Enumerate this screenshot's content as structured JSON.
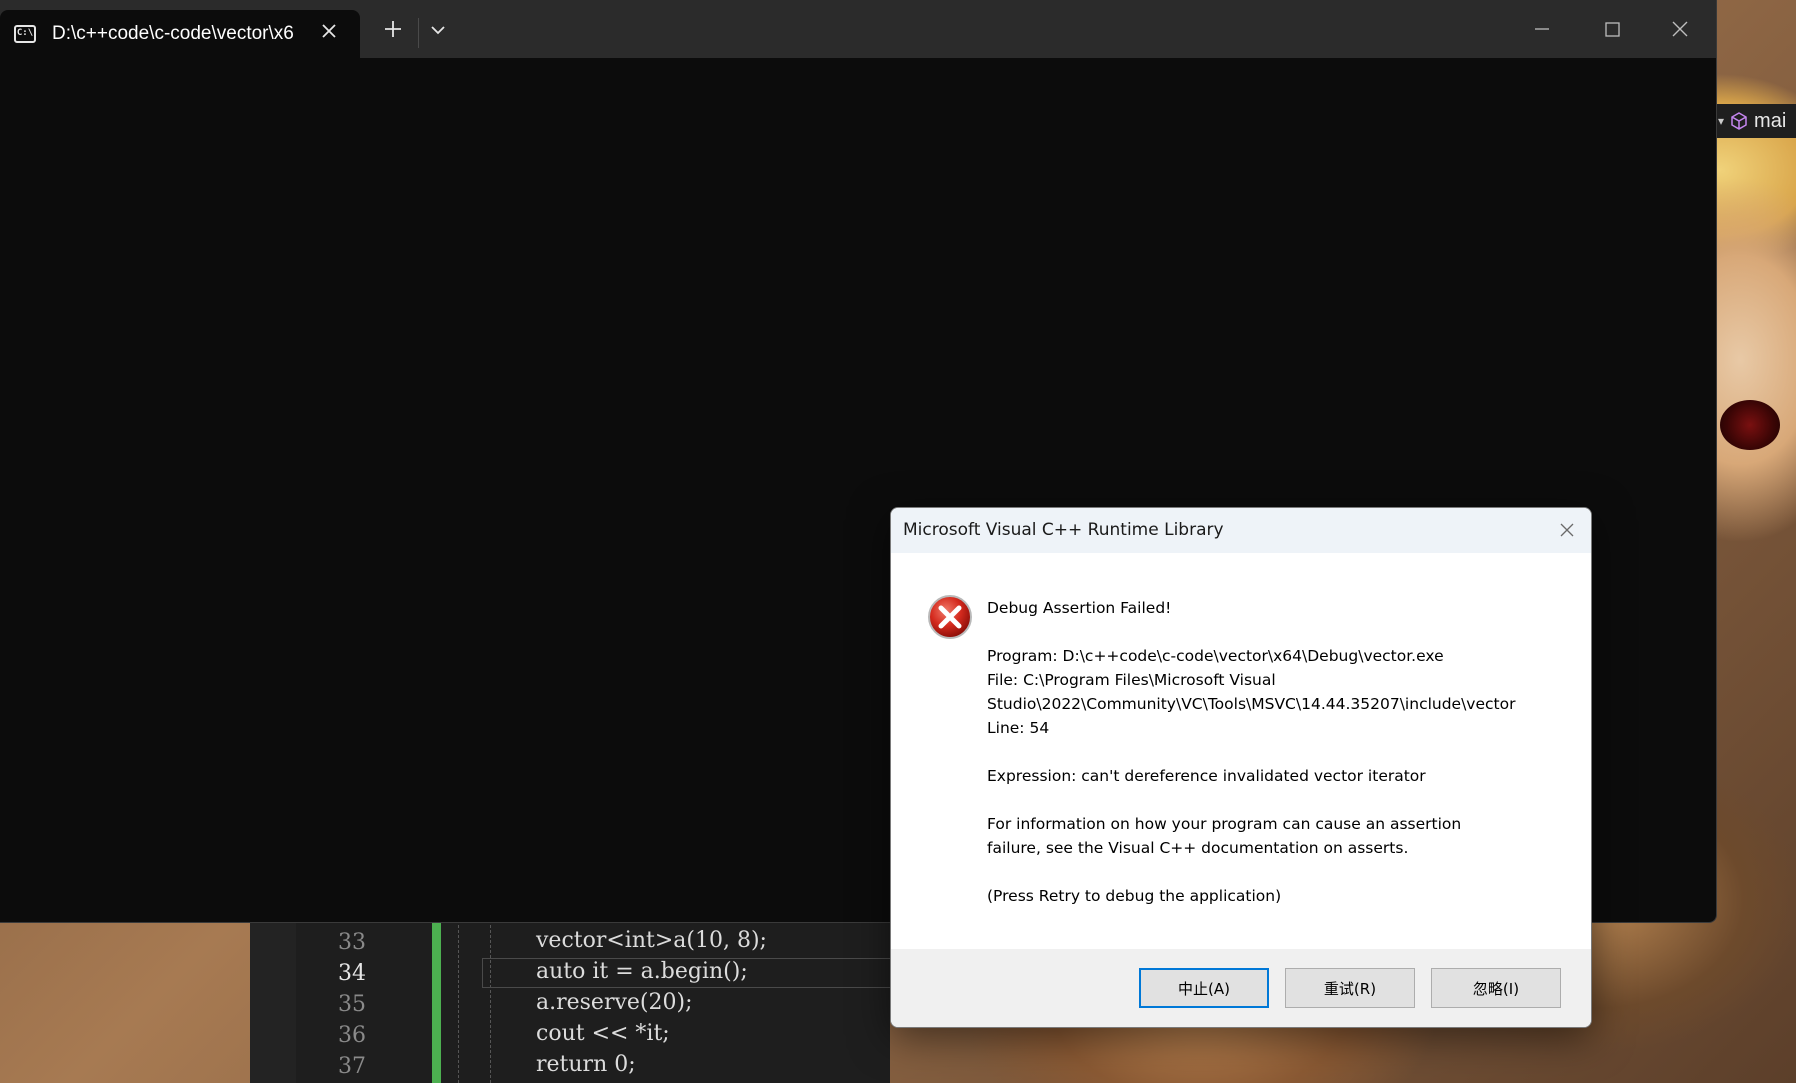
{
  "terminal": {
    "tab_title": "D:\\c++code\\c-code\\vector\\x6",
    "tab_icon_text": "C:\\"
  },
  "vs_fragment": {
    "label": "mai"
  },
  "editor": {
    "lines": [
      {
        "number": "33",
        "code": "vector<int>a(10, 8);"
      },
      {
        "number": "34",
        "code": "auto it = a.begin();"
      },
      {
        "number": "35",
        "code": "a.reserve(20);"
      },
      {
        "number": "36",
        "code": "cout << *it;"
      },
      {
        "number": "37",
        "code": "return 0;"
      }
    ]
  },
  "dialog": {
    "title": "Microsoft Visual C++ Runtime Library",
    "heading": "Debug Assertion Failed!",
    "program": "Program: D:\\c++code\\c-code\\vector\\x64\\Debug\\vector.exe",
    "file_line1": "File: C:\\Program Files\\Microsoft Visual",
    "file_line2": "Studio\\2022\\Community\\VC\\Tools\\MSVC\\14.44.35207\\include\\vector",
    "line": "Line: 54",
    "expression": "Expression: can't dereference invalidated vector iterator",
    "info_line1": "For information on how your program can cause an assertion",
    "info_line2": "failure, see the Visual C++ documentation on asserts.",
    "retry_hint": "(Press Retry to debug the application)",
    "buttons": {
      "abort": "中止(A)",
      "retry": "重试(R)",
      "ignore": "忽略(I)"
    }
  }
}
